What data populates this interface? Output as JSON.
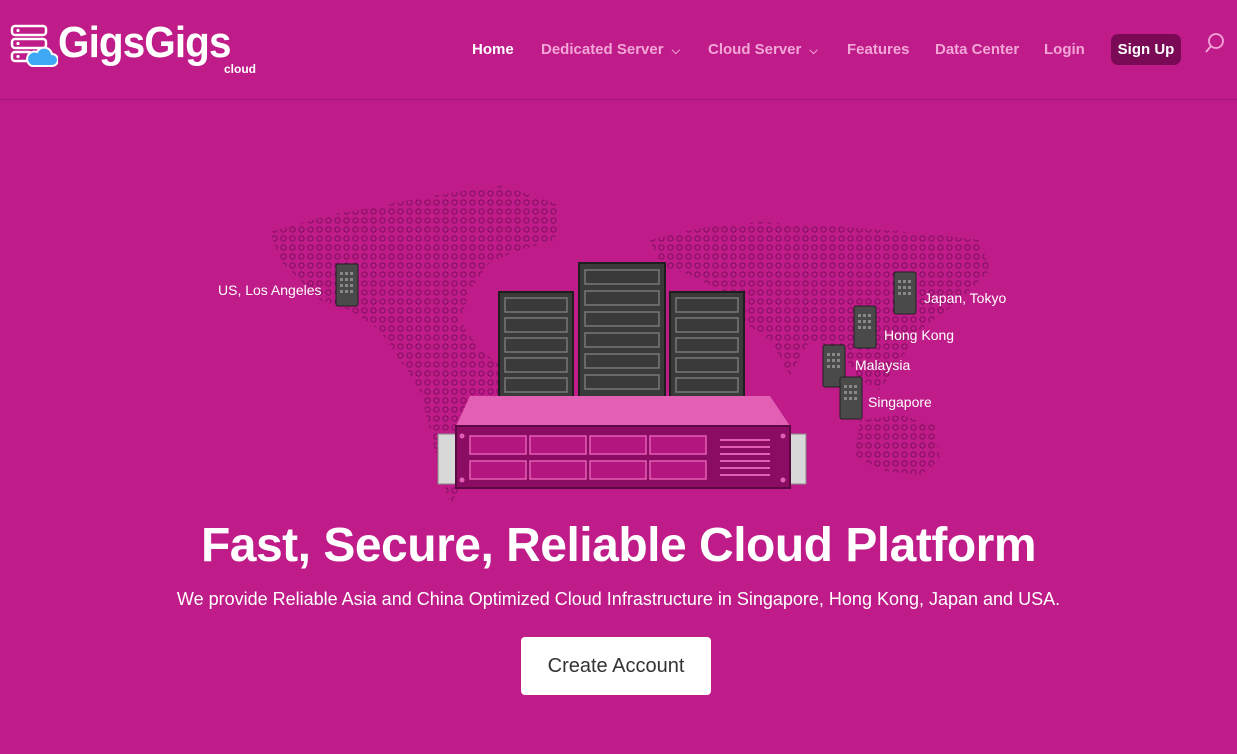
{
  "brand": {
    "name": "GigsGigs",
    "sub": "cloud"
  },
  "nav": {
    "home": "Home",
    "dedicated": "Dedicated Server",
    "cloud": "Cloud Server",
    "features": "Features",
    "datacenter": "Data Center",
    "login": "Login",
    "signup": "Sign Up"
  },
  "locations": {
    "us": "US, Los Angeles",
    "japan": "Japan, Tokyo",
    "hk": "Hong Kong",
    "my": "Malaysia",
    "sg": "Singapore"
  },
  "hero": {
    "title": "Fast, Secure, Reliable Cloud Platform",
    "subtitle": "We provide Reliable Asia and China Optimized Cloud Infrastructure in Singapore, Hong Kong, Japan and USA.",
    "cta": "Create Account"
  },
  "colors": {
    "background": "#bf1b89",
    "accent_dark": "#7a0a55",
    "nav_link": "#f2a6d8"
  }
}
